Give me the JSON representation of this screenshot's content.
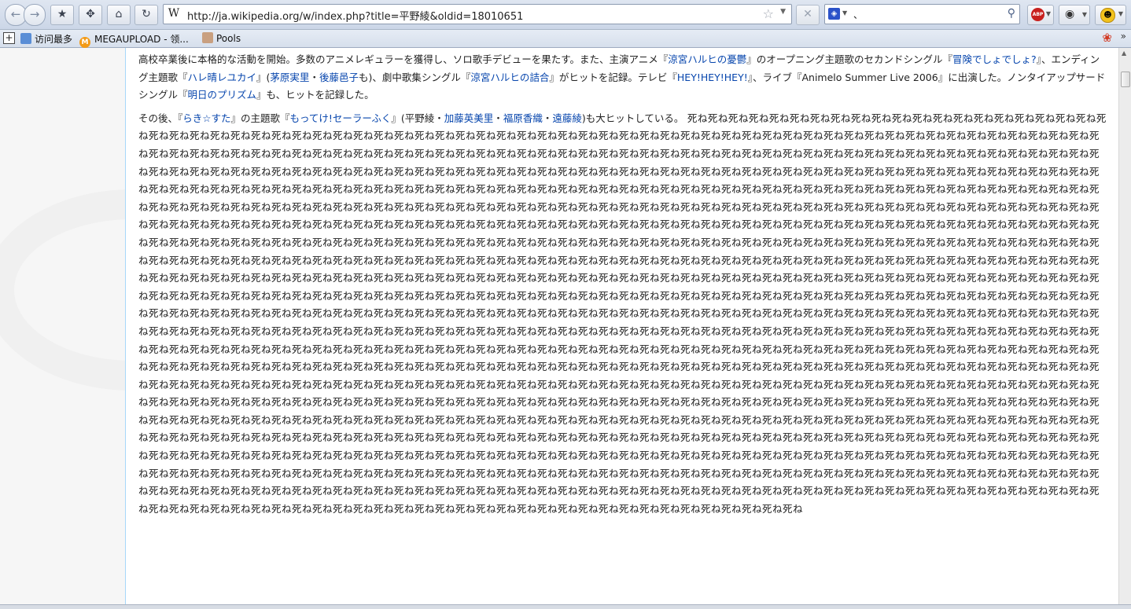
{
  "browser": {
    "url": "http://ja.wikipedia.org/w/index.php?title=平野綾&oldid=18010651",
    "site_icon": "W",
    "search_text": "、"
  },
  "bookmarks": {
    "most_visited": "访问最多",
    "megaupload": "MEGAUPLOAD - 领...",
    "pools": "Pools"
  },
  "article": {
    "p1": [
      {
        "t": "高校卒業後に本格的な活動を開始。多数のアニメレギュラーを獲得し、ソロ歌手デビューを果たす。また、主演アニメ『"
      },
      {
        "t": "涼宮ハルヒの憂鬱",
        "link": true
      },
      {
        "t": "』のオープニング主題歌のセカンドシングル『"
      },
      {
        "t": "冒険でしょでしょ?",
        "link": true
      },
      {
        "t": "』、エンディング主題歌『"
      },
      {
        "t": "ハレ晴レユカイ",
        "link": true
      },
      {
        "t": "』("
      },
      {
        "t": "茅原実里",
        "link": true
      },
      {
        "t": "・"
      },
      {
        "t": "後藤邑子",
        "link": true
      },
      {
        "t": "も)、劇中歌集シングル『"
      },
      {
        "t": "涼宮ハルヒの詰合",
        "link": true
      },
      {
        "t": "』がヒットを記録。テレビ『"
      },
      {
        "t": "HEY!HEY!HEY!",
        "link": true
      },
      {
        "t": "』、ライブ『Animelo Summer Live 2006』に出演した。ノンタイアップサードシングル『"
      },
      {
        "t": "明日のプリズム",
        "link": true
      },
      {
        "t": "』も、ヒットを記録した。"
      }
    ],
    "p2": [
      {
        "t": "その後、『"
      },
      {
        "t": "らき☆すた",
        "link": true
      },
      {
        "t": "』の主題歌『"
      },
      {
        "t": "もってけ!セーラーふく",
        "link": true
      },
      {
        "t": "』(平野綾・"
      },
      {
        "t": "加藤英美里",
        "link": true
      },
      {
        "t": "・"
      },
      {
        "t": "福原香織",
        "link": true
      },
      {
        "t": "・"
      },
      {
        "t": "遠藤綾",
        "link": true
      },
      {
        "t": ")も大ヒットしている。"
      }
    ],
    "spam_word": "死ね",
    "spam_count": 1040
  }
}
